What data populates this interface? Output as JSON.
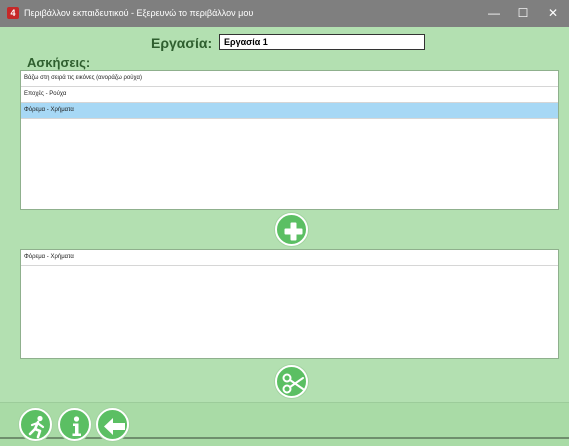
{
  "window": {
    "app_icon": "4",
    "title": "Περιβάλλον εκπαιδευτικού - Εξερευνώ το περιβάλλον μου",
    "minimize": "—",
    "maximize": "☐",
    "close": "✕"
  },
  "task": {
    "label": "Εργασία:",
    "value": "Εργασία 1"
  },
  "exercises": {
    "label": "Ασκήσεις:",
    "items": [
      "Βάζω στη σειρά τις εικόνες (ανοράζω ρούχα)",
      "Εποχές - Ρούχα",
      "Φόρεμα - Χρήματα"
    ],
    "selected_index": 2
  },
  "task_exercises": {
    "items": [
      "Φόρεμα - Χρήματα"
    ]
  },
  "icons": {
    "add": "plus-icon",
    "remove": "scissors-icon",
    "exit": "running-man-icon",
    "info": "info-icon",
    "back": "back-arrow-icon"
  },
  "colors": {
    "background": "#b3e0b1",
    "button_green": "#5bbf63",
    "selection_blue": "#a7d8f5",
    "titlebar_gray": "#7f7f7f"
  }
}
